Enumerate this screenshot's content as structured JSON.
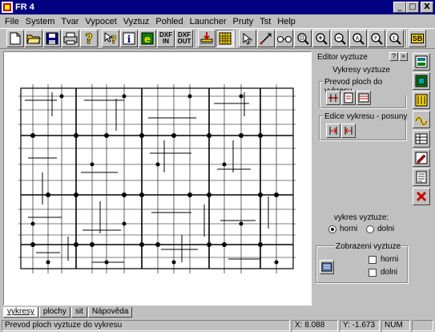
{
  "window": {
    "title": "FR 4",
    "minimize": "_",
    "maximize": "□",
    "close": "X"
  },
  "menu": [
    "File",
    "System",
    "Tvar",
    "Vypocet",
    "Vyztuz",
    "Pohled",
    "Launcher",
    "Pruty",
    "Tst",
    "Help"
  ],
  "toolbar": {
    "dxf_in_top": "DXF",
    "dxf_in_bottom": "IN",
    "dxf_out_top": "DXF",
    "dxf_out_bottom": "OUT",
    "icons": [
      "new-file-icon",
      "open-folder-icon",
      "save-icon",
      "print-icon",
      "help-question-icon",
      "context-help-icon",
      "info-icon",
      "internet-explorer-icon",
      "dxf-in-icon",
      "dxf-out-icon",
      "load-icon",
      "grid-icon",
      "select-pointer-icon",
      "draw-line-icon",
      "glasses-icon",
      "zoom-window-icon",
      "zoom-in-icon",
      "zoom-out-icon",
      "zoom-all-icon",
      "zoom-previous-icon",
      "zoom-extents-icon",
      "sb-icon"
    ],
    "sb_label": "SB"
  },
  "editor": {
    "title": "Editor vyztuze",
    "help_btn": "?",
    "close_btn": "×",
    "subtitle": "Vykresy vyztuze",
    "group1_label": "Prevod ploch do vykresu",
    "group2_label": "Edice vykresu - posuny",
    "vykres_label": "vykres vyztuze:",
    "radio_horni": "horni",
    "radio_dolni": "dolni",
    "radio_selected": "horni",
    "group3_label": "Zobrazeni vyztuze",
    "chk_horni": "horni",
    "chk_dolni": "dolni"
  },
  "right_toolbar": {
    "icons": [
      "layers-icon",
      "plate-reinforcement-icon",
      "bars-icon",
      "wave-icon",
      "table-icon",
      "edit-drawing-icon",
      "list-icon",
      "delete-x-icon"
    ]
  },
  "tabs": [
    {
      "label": "vykresy",
      "active": true
    },
    {
      "label": "plochy",
      "active": false
    },
    {
      "label": "sit",
      "active": false
    },
    {
      "label": "Nápověda",
      "active": false
    }
  ],
  "status": {
    "message": "Prevod ploch vyztuze do vykresu",
    "x": "X:  8.088",
    "y": "Y: -1.673",
    "num": "NUM"
  },
  "colors": {
    "titlebar": "#000080",
    "face": "#c0c0c0",
    "canvas": "#ffffff",
    "accent_red": "#cc0000",
    "accent_yellow": "#ffd800"
  }
}
